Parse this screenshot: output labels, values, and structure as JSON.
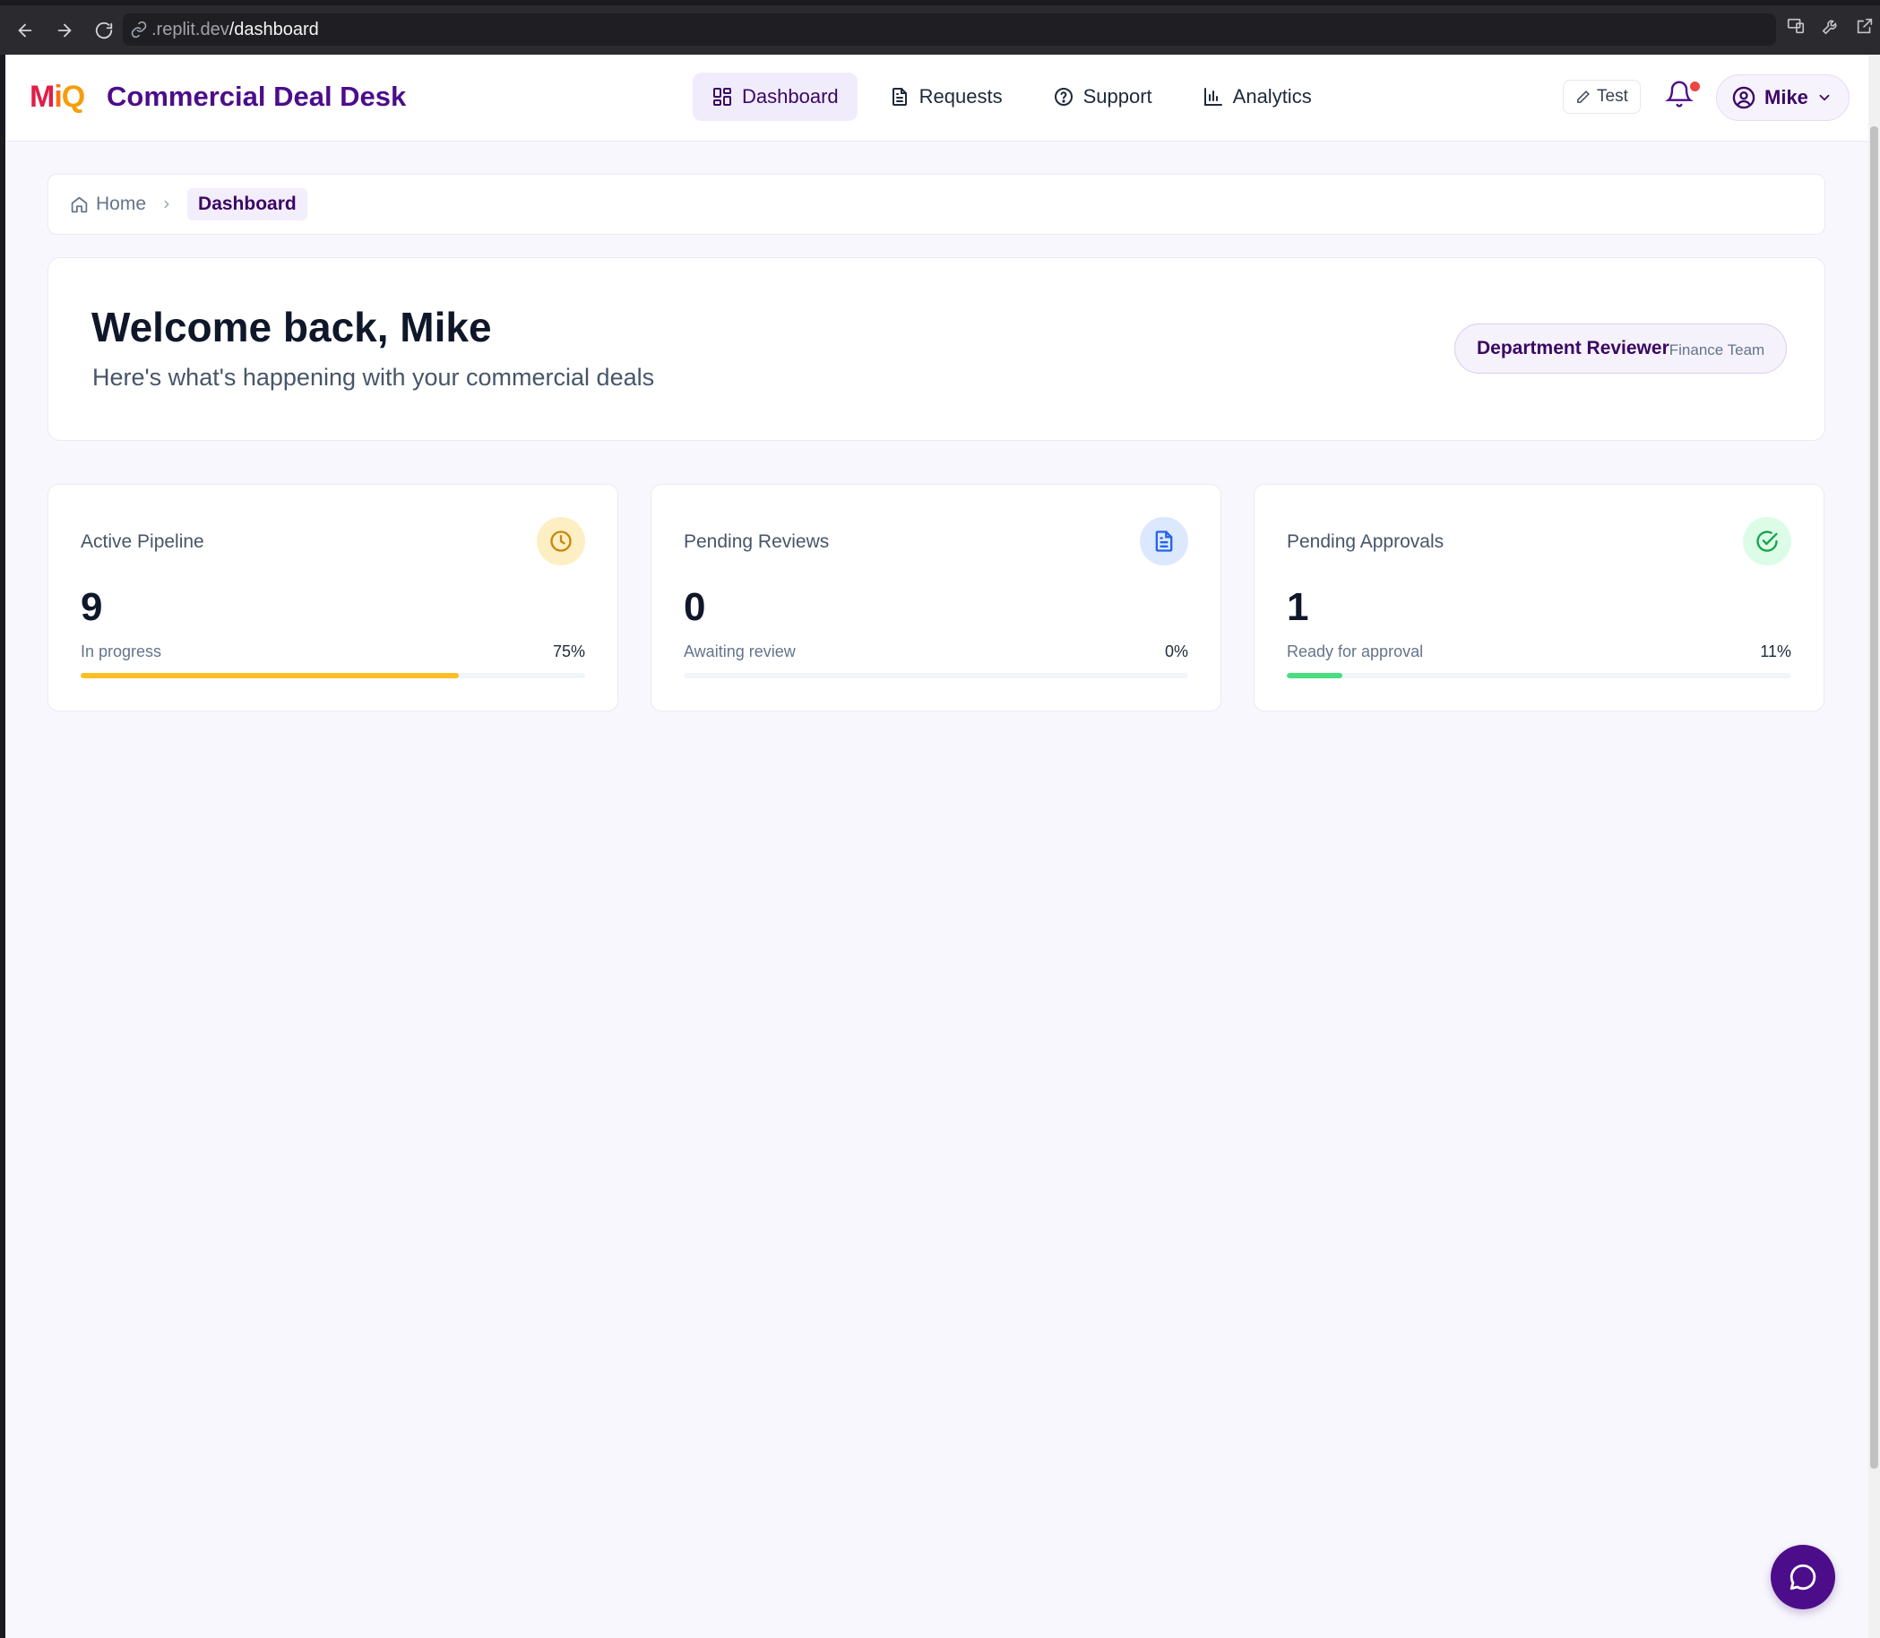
{
  "browser": {
    "url_host": ".replit.dev",
    "url_path": "/dashboard"
  },
  "header": {
    "logo": {
      "m": "M",
      "i": "i",
      "q": "Q"
    },
    "title": "Commercial Deal Desk",
    "nav": [
      {
        "label": "Dashboard",
        "icon": "grid-icon",
        "active": true
      },
      {
        "label": "Requests",
        "icon": "document-icon",
        "active": false
      },
      {
        "label": "Support",
        "icon": "help-circle-icon",
        "active": false
      },
      {
        "label": "Analytics",
        "icon": "bar-chart-icon",
        "active": false
      }
    ],
    "test_label": "Test",
    "user_name": "Mike"
  },
  "breadcrumb": {
    "home": "Home",
    "current": "Dashboard"
  },
  "welcome": {
    "title": "Welcome back, Mike",
    "subtitle": "Here's what's happening with your commercial deals",
    "role": "Department Reviewer",
    "team": "Finance Team"
  },
  "stats": [
    {
      "label": "Active Pipeline",
      "value": "9",
      "caption": "In progress",
      "percent": "75%",
      "progress": 0.75,
      "icon": "clock-icon",
      "icon_bg": "#fdefc3",
      "icon_color": "#c9860a",
      "bar_color": "#fbbf24"
    },
    {
      "label": "Pending Reviews",
      "value": "0",
      "caption": "Awaiting review",
      "percent": "0%",
      "progress": 0,
      "icon": "document-icon",
      "icon_bg": "#dbe8fe",
      "icon_color": "#2563eb",
      "bar_color": "#3b82f6"
    },
    {
      "label": "Pending Approvals",
      "value": "1",
      "caption": "Ready for approval",
      "percent": "11%",
      "progress": 0.11,
      "icon": "check-circle-icon",
      "icon_bg": "#dcfce7",
      "icon_color": "#16a34a",
      "bar_color": "#4ade80"
    }
  ],
  "colors": {
    "brand": "#4c0d8a",
    "notification_dot": "#ef4444"
  }
}
